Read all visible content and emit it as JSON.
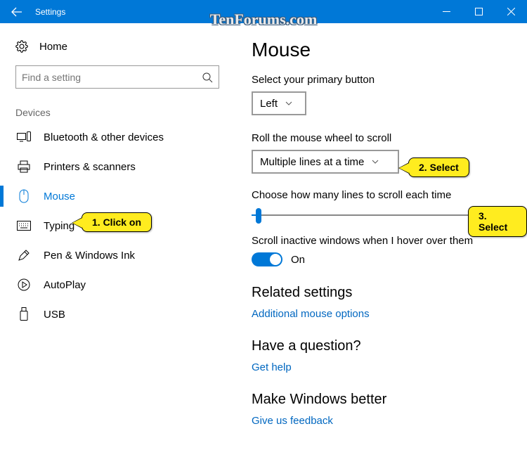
{
  "window": {
    "title": "Settings"
  },
  "watermark": "TenForums.com",
  "sidebar": {
    "home": "Home",
    "search_placeholder": "Find a setting",
    "category": "Devices",
    "items": [
      {
        "label": "Bluetooth & other devices"
      },
      {
        "label": "Printers & scanners"
      },
      {
        "label": "Mouse"
      },
      {
        "label": "Typing"
      },
      {
        "label": "Pen & Windows Ink"
      },
      {
        "label": "AutoPlay"
      },
      {
        "label": "USB"
      }
    ]
  },
  "main": {
    "heading": "Mouse",
    "primary_label": "Select your primary button",
    "primary_value": "Left",
    "scroll_mode_label": "Roll the mouse wheel to scroll",
    "scroll_mode_value": "Multiple lines at a time",
    "lines_label": "Choose how many lines to scroll each time",
    "inactive_label": "Scroll inactive windows when I hover over them",
    "toggle_state": "On",
    "related_heading": "Related settings",
    "related_link": "Additional mouse options",
    "question_heading": "Have a question?",
    "question_link": "Get help",
    "feedback_heading": "Make Windows better",
    "feedback_link": "Give us feedback"
  },
  "callouts": {
    "c1": "1. Click on",
    "c2": "2. Select",
    "c3": "3. Select"
  },
  "colors": {
    "accent": "#0078d7",
    "callout": "#ffec1f"
  }
}
